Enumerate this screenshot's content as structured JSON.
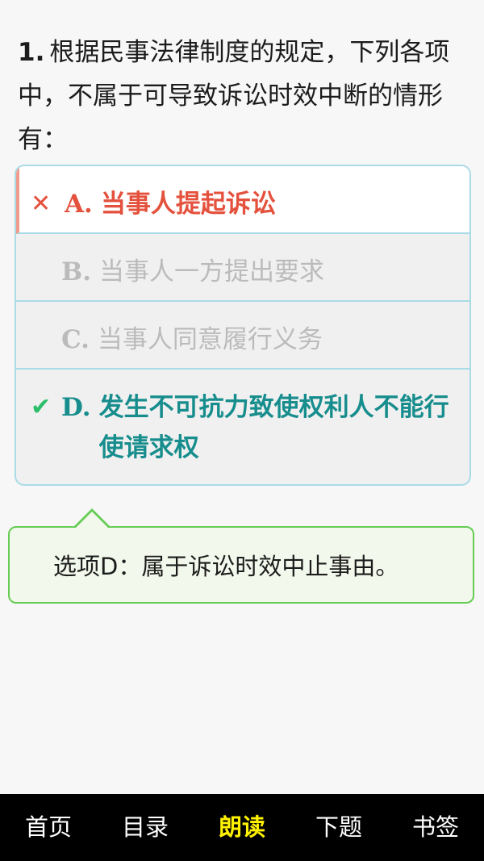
{
  "question": {
    "number": "1.",
    "text": "根据民事法律制度的规定，下列各项中，不属于可导致诉讼时效中断的情形有："
  },
  "options": [
    {
      "status": "wrong",
      "mark": "✕",
      "letter": "A.",
      "text": "当事人提起诉讼"
    },
    {
      "status": "neutral",
      "mark": "",
      "letter": "B.",
      "text": "当事人一方提出要求"
    },
    {
      "status": "neutral",
      "mark": "",
      "letter": "C.",
      "text": "当事人同意履行义务"
    },
    {
      "status": "correct",
      "mark": "✔",
      "letter": "D.",
      "text": "发生不可抗力致使权利人不能行使请求权"
    }
  ],
  "explanation": "选项D：属于诉讼时效中止事由。",
  "nav": {
    "home": "首页",
    "catalog": "目录",
    "read_aloud": "朗读",
    "next": "下题",
    "bookmark": "书签",
    "active": "read_aloud"
  },
  "colors": {
    "wrong": "#e4513d",
    "correct_text": "#178d8d",
    "correct_mark": "#2bbf6a",
    "option_border": "#a9dbe7",
    "explain_border": "#66cc55",
    "nav_active": "#fff200"
  }
}
